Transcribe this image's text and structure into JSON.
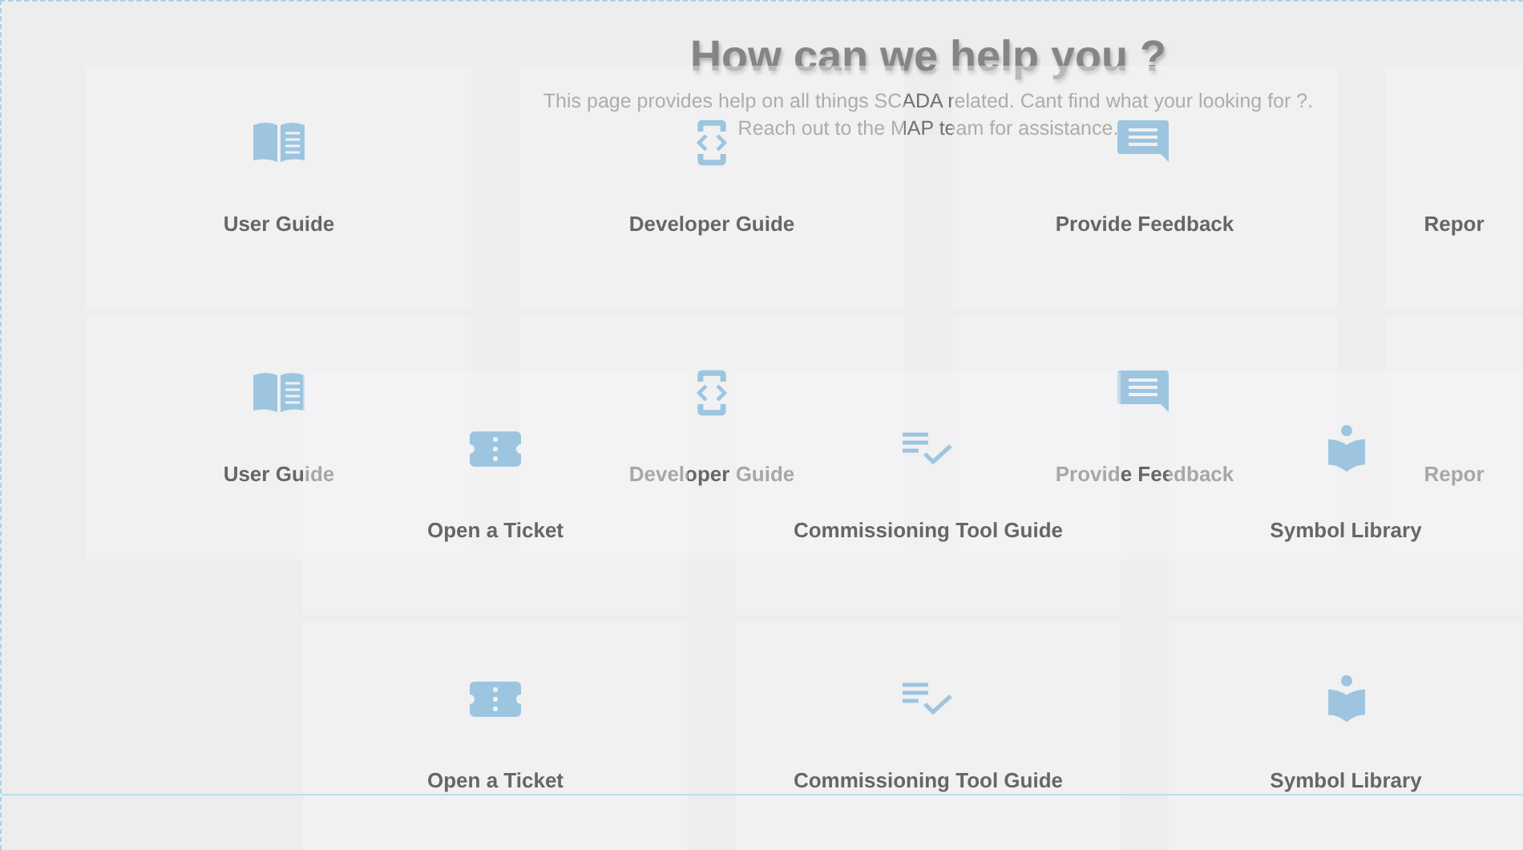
{
  "header": {
    "title": "How can we help you ?",
    "description": [
      "This page provides help on all things SCADA related. Cant find what your looking for ?.",
      "Reach out to the MAP team for assistance."
    ]
  },
  "layers": [
    {
      "cards": [
        {
          "kind": "guide",
          "label": "User Guide"
        },
        {
          "kind": "developer",
          "label": "Developer Guide"
        },
        {
          "kind": "feedback",
          "label": "Provide Feedback"
        },
        {
          "kind": "report",
          "label": "Repor"
        }
      ]
    },
    {
      "cards": [
        {
          "kind": "guide",
          "label": "User Guide"
        },
        {
          "kind": "developer",
          "label": "Developer Guide"
        },
        {
          "kind": "feedback",
          "label": "Provide Feedback"
        },
        {
          "kind": "report",
          "label": "Repor"
        }
      ]
    },
    {
      "cards": [
        {
          "kind": "ticket",
          "label": "Open a Ticket"
        },
        {
          "kind": "commissioning",
          "label": "Commissioning Tool Guide"
        },
        {
          "kind": "library",
          "label": "Symbol Library"
        }
      ]
    },
    {
      "cards": [
        {
          "kind": "ticket",
          "label": "Open a Ticket"
        },
        {
          "kind": "commissioning",
          "label": "Commissioning Tool Guide"
        },
        {
          "kind": "library",
          "label": "Symbol Library"
        }
      ]
    }
  ]
}
